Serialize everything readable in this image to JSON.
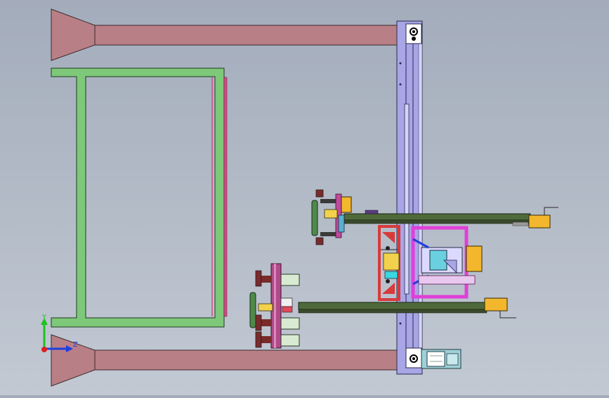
{
  "view": {
    "background_top": "#a3acbb",
    "background_bottom": "#c2c9d3"
  },
  "triad": {
    "axis_y_label": "Y",
    "axis_z_label": "Z",
    "y_color": "#1fc21f",
    "z_color": "#1f3fe0",
    "x_color": "#e01f1f"
  },
  "palette": {
    "beam": "#b97f86",
    "frame": "#7ec87a",
    "rail": "#a8a6e6",
    "rod": "#4f6a3a",
    "accent_yellow": "#f2b72c",
    "accent_magenta": "#e040d8",
    "accent_red": "#d83a3a",
    "accent_cyan": "#3ad8e0"
  }
}
